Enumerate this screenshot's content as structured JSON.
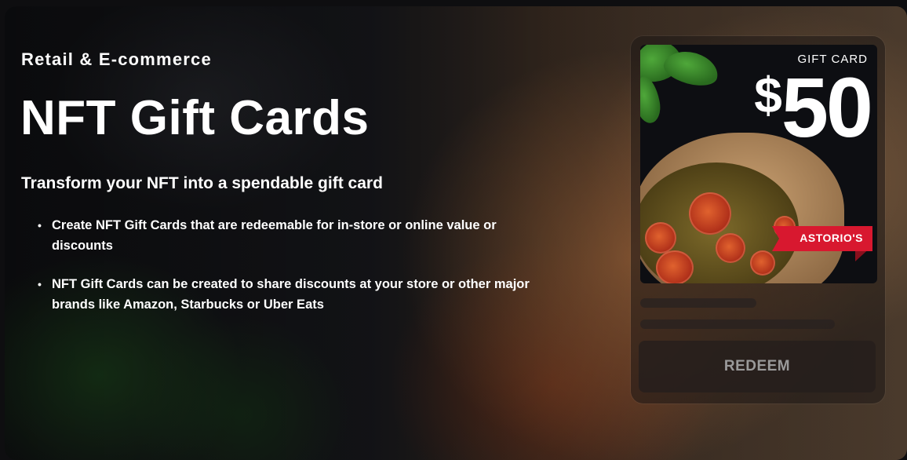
{
  "hero": {
    "eyebrow": "Retail & E-commerce",
    "title": "NFT Gift Cards",
    "subtitle": "Transform your NFT into a spendable gift card",
    "bullets": [
      "Create NFT Gift Cards that are redeemable for in-store or online value or discounts",
      "NFT Gift Cards can be created to share discounts at your store or other major brands like Amazon, Starbucks or Uber Eats"
    ]
  },
  "gift_card": {
    "label": "GIFT CARD",
    "currency": "$",
    "amount": "50",
    "brand": "ASTORIO'S",
    "brand_color": "#d8182f",
    "redeem_label": "REDEEM"
  },
  "colors": {
    "text": "#ffffff",
    "redeem_text": "#9a9a9a"
  }
}
